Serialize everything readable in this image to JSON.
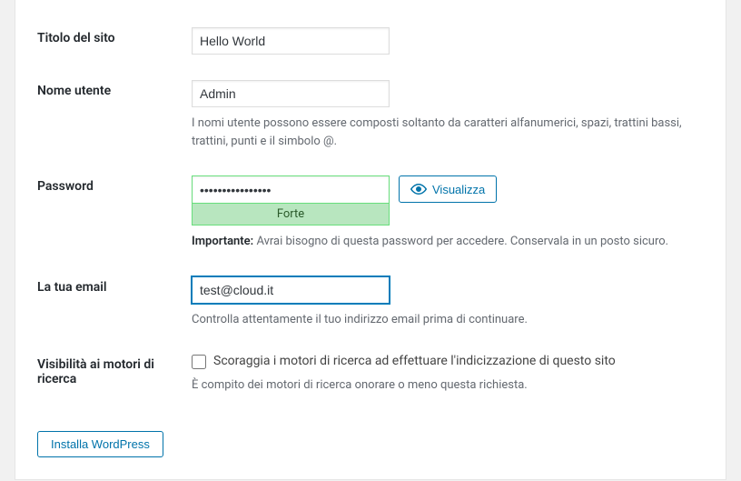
{
  "form": {
    "siteTitle": {
      "label": "Titolo del sito",
      "value": "Hello World"
    },
    "username": {
      "label": "Nome utente",
      "value": "Admin",
      "hint": "I nomi utente possono essere composti soltanto da caratteri alfanumerici, spazi, trattini bassi, trattini, punti e il simbolo @."
    },
    "password": {
      "label": "Password",
      "value": "••••••••••••••••",
      "strength": "Forte",
      "toggleLabel": "Visualizza",
      "noteStrong": "Importante:",
      "noteRest": " Avrai bisogno di questa password per accedere. Conservala in un posto sicuro."
    },
    "email": {
      "label": "La tua email",
      "value": "test@cloud.it",
      "hint": "Controlla attentamente il tuo indirizzo email prima di continuare."
    },
    "searchVisibility": {
      "label": "Visibilità ai motori di ricerca",
      "checkboxLabel": "Scoraggia i motori di ricerca ad effettuare l'indicizzazione di questo sito",
      "hint": "È compito dei motori di ricerca onorare o meno questa richiesta."
    },
    "submitLabel": "Installa WordPress"
  }
}
